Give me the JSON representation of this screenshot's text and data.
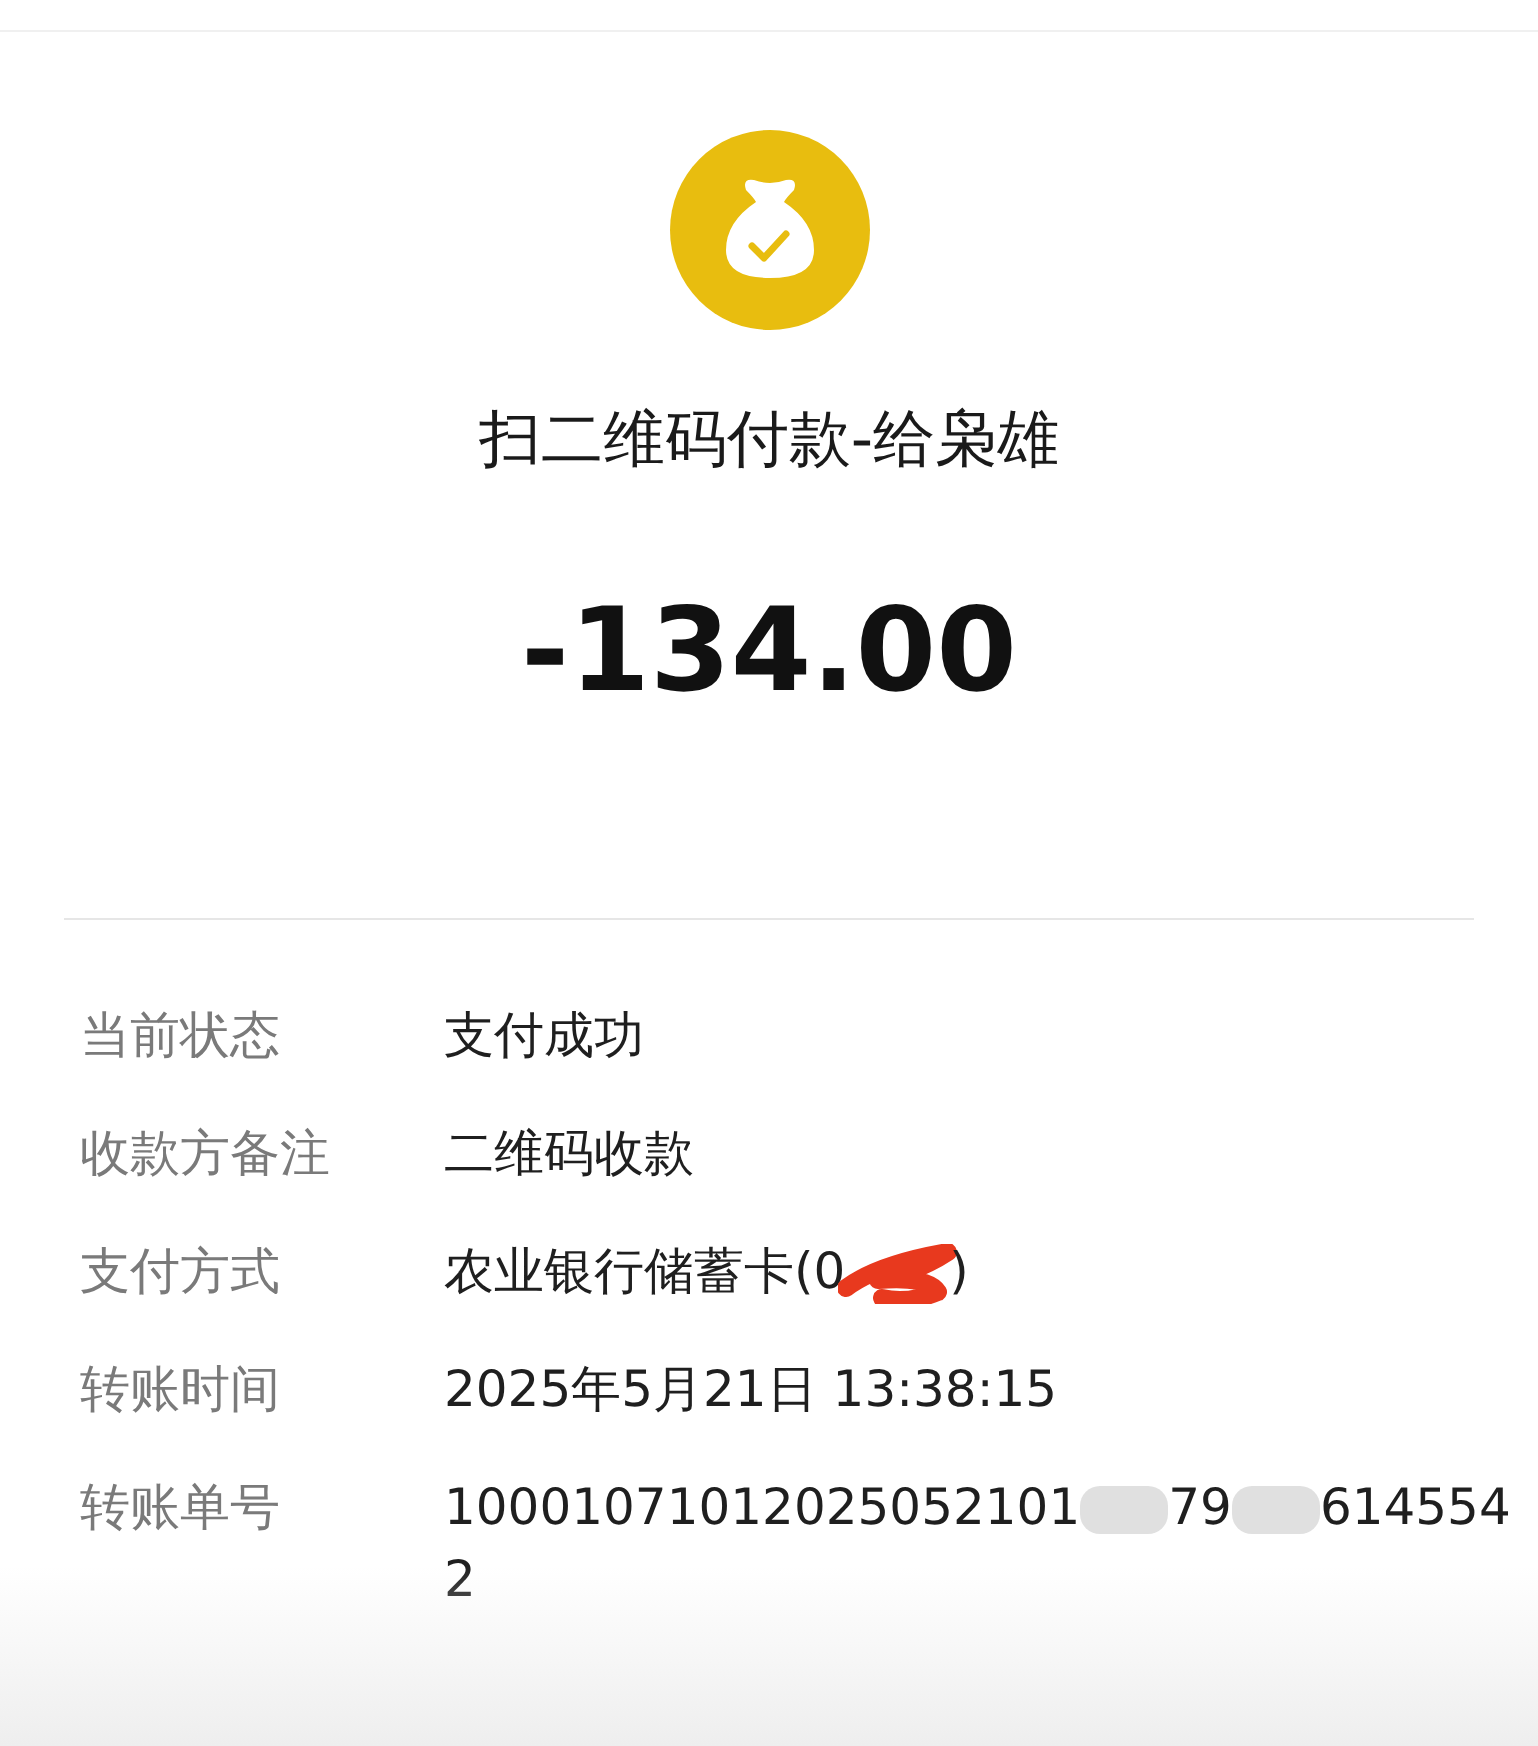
{
  "title": "扫二维码付款-给枭雄",
  "amount": "-134.00",
  "details": [
    {
      "label": "当前状态",
      "parts": [
        {
          "kind": "text",
          "text": "支付成功"
        }
      ]
    },
    {
      "label": "收款方备注",
      "parts": [
        {
          "kind": "text",
          "text": "二维码收款"
        }
      ]
    },
    {
      "label": "支付方式",
      "parts": [
        {
          "kind": "text",
          "text": "农业银行储蓄卡(0"
        },
        {
          "kind": "scribble"
        },
        {
          "kind": "text",
          "text": ")"
        }
      ]
    },
    {
      "label": "转账时间",
      "parts": [
        {
          "kind": "text",
          "text": "2025年5月21日 13:38:15"
        }
      ]
    },
    {
      "label": "转账单号",
      "parts": [
        {
          "kind": "text",
          "text": "10001071012025052101"
        },
        {
          "kind": "blur"
        },
        {
          "kind": "text",
          "text": "79"
        },
        {
          "kind": "blur"
        },
        {
          "kind": "text",
          "text": "614554"
        },
        {
          "kind": "break"
        },
        {
          "kind": "text",
          "text": "2"
        }
      ]
    }
  ]
}
